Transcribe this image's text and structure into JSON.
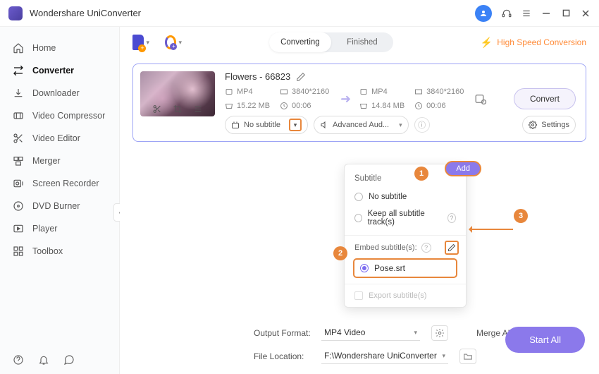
{
  "app_title": "Wondershare UniConverter",
  "sidebar": {
    "items": [
      {
        "label": "Home"
      },
      {
        "label": "Converter"
      },
      {
        "label": "Downloader"
      },
      {
        "label": "Video Compressor"
      },
      {
        "label": "Video Editor"
      },
      {
        "label": "Merger"
      },
      {
        "label": "Screen Recorder"
      },
      {
        "label": "DVD Burner"
      },
      {
        "label": "Player"
      },
      {
        "label": "Toolbox"
      }
    ]
  },
  "tabs": {
    "converting": "Converting",
    "finished": "Finished"
  },
  "hispeed_label": "High Speed Conversion",
  "file": {
    "title": "Flowers - 66823",
    "src": {
      "format": "MP4",
      "res": "3840*2160",
      "size": "15.22 MB",
      "dur": "00:06"
    },
    "dst": {
      "format": "MP4",
      "res": "3840*2160",
      "size": "14.84 MB",
      "dur": "00:06"
    },
    "convert_label": "Convert"
  },
  "controls": {
    "subtitle_select": "No subtitle",
    "audio_select": "Advanced Aud...",
    "settings_label": "Settings"
  },
  "dropdown": {
    "header": "Subtitle",
    "opt_none": "No subtitle",
    "opt_keep": "Keep all subtitle track(s)",
    "embed_label": "Embed subtitle(s):",
    "file_name": "Pose.srt",
    "export_label": "Export subtitle(s)",
    "add_label": "Add"
  },
  "footer": {
    "output_format_label": "Output Format:",
    "output_format_value": "MP4 Video",
    "merge_label": "Merge All Files:",
    "file_location_label": "File Location:",
    "file_location_value": "F:\\Wondershare UniConverter",
    "start_all": "Start All"
  },
  "steps": {
    "s1": "1",
    "s2": "2",
    "s3": "3"
  }
}
